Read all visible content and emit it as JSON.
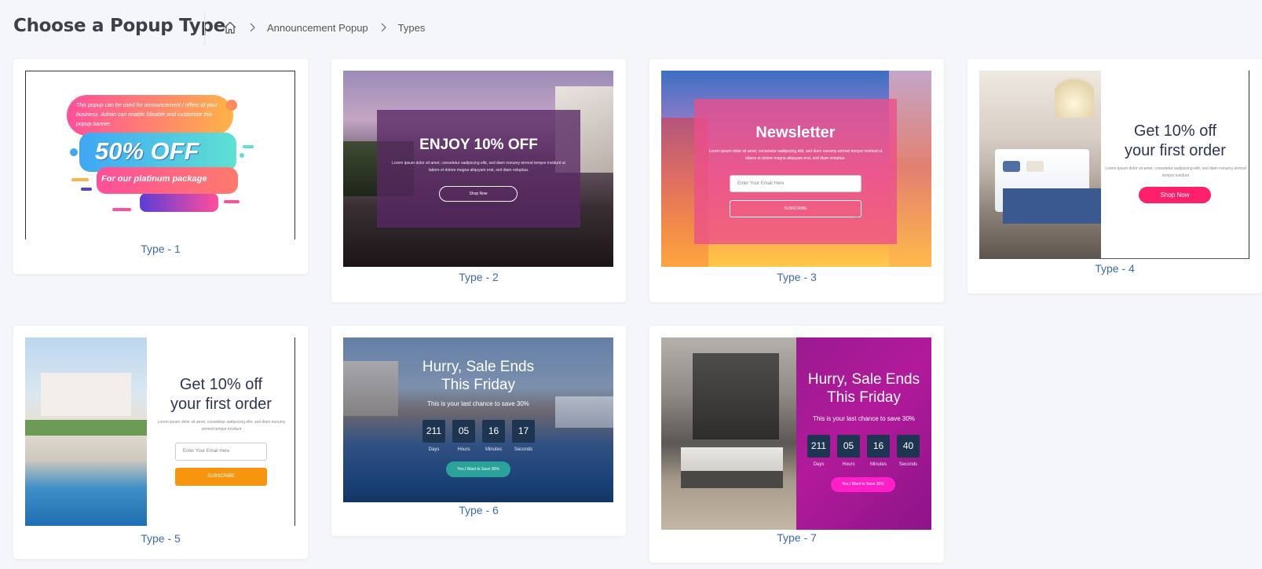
{
  "header": {
    "title": "Choose a Popup Type",
    "breadcrumb": {
      "items": [
        "Announcement Popup",
        "Types"
      ]
    }
  },
  "types": [
    {
      "label": "Type - 1",
      "preview": {
        "small_text": "This popup can be used for announcement / offers of your business. Admin can enable /disable and customize this popup banner.",
        "headline": "50% OFF",
        "sub": "For our platinum package"
      }
    },
    {
      "label": "Type - 2",
      "preview": {
        "headline": "ENJOY 10% OFF",
        "body": "Lorem ipsum dolor sit amet, consetetur sadipscing elitr, sed diam nonumy eirmod tempor invidunt ut labore et dolore magna aliquyam erat, sed diam voluptua.",
        "button": "Shop Now"
      }
    },
    {
      "label": "Type - 3",
      "preview": {
        "headline": "Newsletter",
        "body": "Lorem ipsum dolor sit amet, consetetur sadipscing elitr, sed diam nonumy eirmod tempor invidunt ut labore et dolore magna aliquyam erat, sed diam voluptua.",
        "input_placeholder": "Enter Your Email Here",
        "button": "SUBSCRIBE"
      }
    },
    {
      "label": "Type - 4",
      "preview": {
        "headline_1": "Get 10% off",
        "headline_2": "your first order",
        "body": "Lorem ipsum dolor sit amet, consetetur sadipscing elitr, sed diam nonumy eirmod tempor invidunt",
        "button": "Shop Now"
      }
    },
    {
      "label": "Type - 5",
      "preview": {
        "headline_1": "Get 10% off",
        "headline_2": "your first order",
        "body": "Lorem ipsum dolor sit amet, consetetur sadipscing elitr, sed diam nonumy eirmod tempor invidunt",
        "input_placeholder": "Enter Your Email Here",
        "button": "SUBSCRIBE"
      }
    },
    {
      "label": "Type - 6",
      "preview": {
        "headline_1": "Hurry, Sale Ends",
        "headline_2": "This Friday",
        "sub": "This is your last chance to save 30%",
        "countdown": [
          {
            "value": "211",
            "unit": "Days"
          },
          {
            "value": "05",
            "unit": "Hours"
          },
          {
            "value": "16",
            "unit": "Minutes"
          },
          {
            "value": "17",
            "unit": "Seconds"
          }
        ],
        "button": "Yes,I Want to Save 30%"
      }
    },
    {
      "label": "Type - 7",
      "preview": {
        "headline_1": "Hurry, Sale Ends",
        "headline_2": "This Friday",
        "sub": "This is your last chance to save 30%",
        "countdown": [
          {
            "value": "211",
            "unit": "Days"
          },
          {
            "value": "05",
            "unit": "Hours"
          },
          {
            "value": "16",
            "unit": "Minutes"
          },
          {
            "value": "40",
            "unit": "Seconds"
          }
        ],
        "button": "Yes,I Want to Save 30%"
      }
    }
  ],
  "colors": {
    "link": "#3d6aa8",
    "background": "#f5f6fa",
    "card": "#ffffff"
  }
}
